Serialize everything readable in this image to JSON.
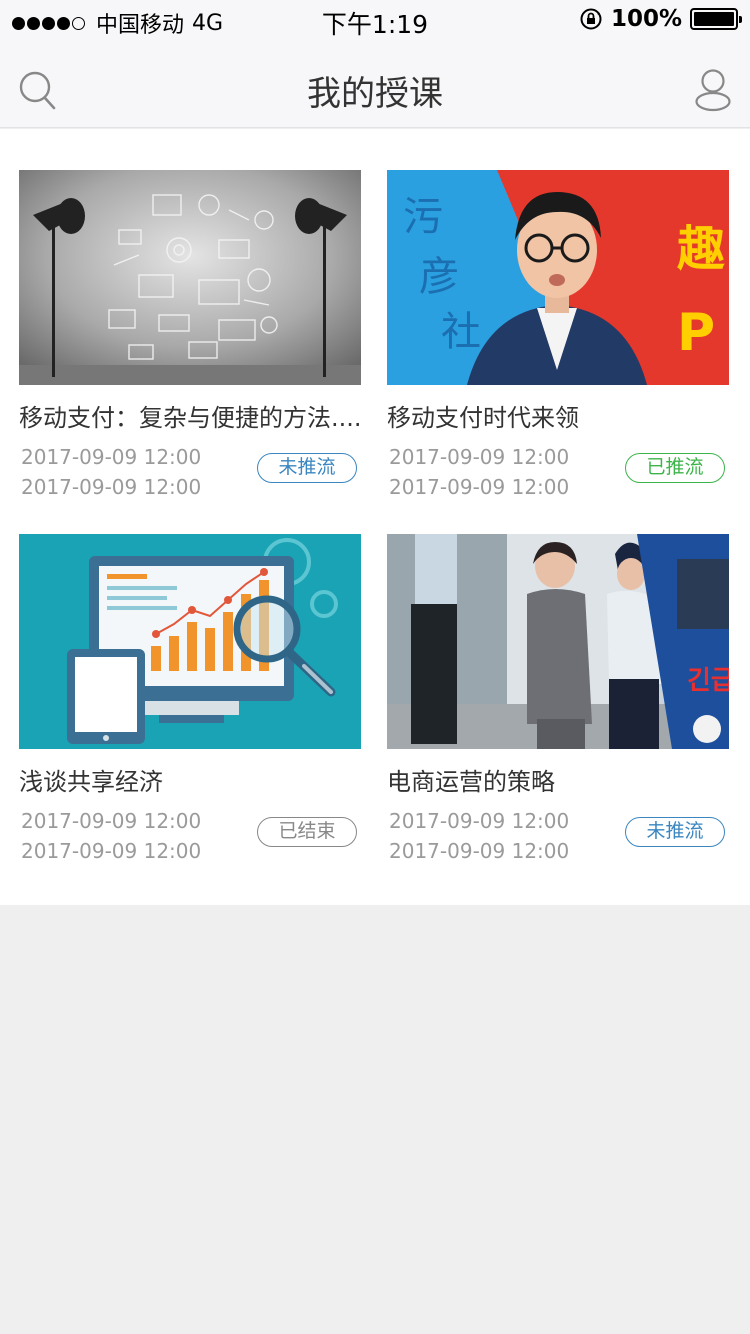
{
  "status_bar": {
    "carrier": "中国移动",
    "network": "4G",
    "time": "下午1:19",
    "battery": "100%"
  },
  "nav": {
    "title": "我的授课",
    "search_icon": "search-icon",
    "user_icon": "user-icon"
  },
  "courses": [
    {
      "title": "移动支付：复杂与便捷的方法.....",
      "start": "2017-09-09 12:00",
      "end": "2017-09-09 12:00",
      "status": "未推流",
      "status_color": "#3b86c0",
      "image": "photo-studio-lights"
    },
    {
      "title": "移动支付时代来领",
      "start": "2017-09-09 12:00",
      "end": "2017-09-09 12:00",
      "status": "已推流",
      "status_color": "#3cb44a",
      "image": "man-portrait-poster"
    },
    {
      "title": "浅谈共享经济",
      "start": "2017-09-09 12:00",
      "end": "2017-09-09 12:00",
      "status": "已结束",
      "status_color": "#888888",
      "image": "analytics-illustration"
    },
    {
      "title": "电商运营的策略",
      "start": "2017-09-09 12:00",
      "end": "2017-09-09 12:00",
      "status": "未推流",
      "status_color": "#3b86c0",
      "image": "news-photo-escort"
    }
  ]
}
